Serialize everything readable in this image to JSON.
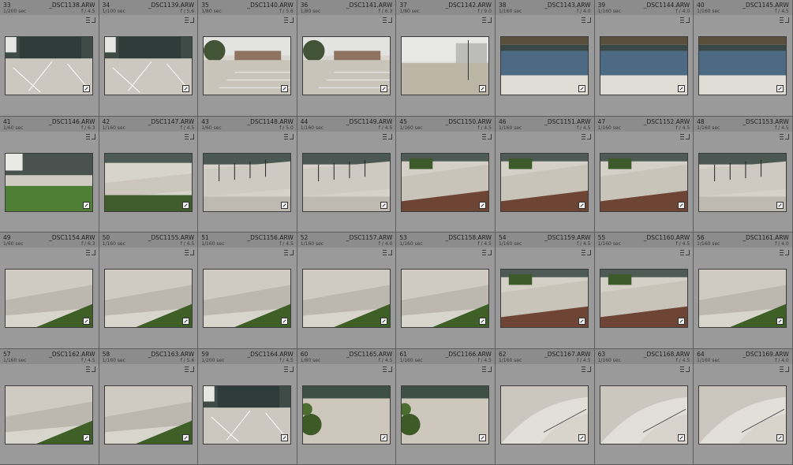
{
  "cells": [
    {
      "index": "33",
      "filename": "_DSC1138.ARW",
      "shutter": "1/200 sec",
      "aperture": "f / 4.5",
      "scene": "plaza-building"
    },
    {
      "index": "34",
      "filename": "_DSC1139.ARW",
      "shutter": "1/100 sec",
      "aperture": "f / 5.6",
      "scene": "plaza-building"
    },
    {
      "index": "35",
      "filename": "_DSC1140.ARW",
      "shutter": "1/80 sec",
      "aperture": "f / 5.6",
      "scene": "steps-tree"
    },
    {
      "index": "36",
      "filename": "_DSC1141.ARW",
      "shutter": "1/80 sec",
      "aperture": "f / 6.3",
      "scene": "steps-tree"
    },
    {
      "index": "37",
      "filename": "_DSC1142.ARW",
      "shutter": "1/80 sec",
      "aperture": "f / 9.0",
      "scene": "plaza-lamp"
    },
    {
      "index": "38",
      "filename": "_DSC1143.ARW",
      "shutter": "1/160 sec",
      "aperture": "f / 4.0",
      "scene": "facade"
    },
    {
      "index": "39",
      "filename": "_DSC1144.ARW",
      "shutter": "1/160 sec",
      "aperture": "f / 4.0",
      "scene": "facade"
    },
    {
      "index": "40",
      "filename": "_DSC1145.ARW",
      "shutter": "1/160 sec",
      "aperture": "f / 4.5",
      "scene": "facade"
    },
    {
      "index": "41",
      "filename": "_DSC1146.ARW",
      "shutter": "1/60 sec",
      "aperture": "f / 6.3",
      "scene": "lawn"
    },
    {
      "index": "42",
      "filename": "_DSC1147.ARW",
      "shutter": "1/160 sec",
      "aperture": "f / 4.5",
      "scene": "ramp-hedge"
    },
    {
      "index": "43",
      "filename": "_DSC1148.ARW",
      "shutter": "1/60 sec",
      "aperture": "f / 5.0",
      "scene": "ramp-rail"
    },
    {
      "index": "44",
      "filename": "_DSC1149.ARW",
      "shutter": "1/160 sec",
      "aperture": "f / 4.5",
      "scene": "ramp-rail"
    },
    {
      "index": "45",
      "filename": "_DSC1150.ARW",
      "shutter": "1/160 sec",
      "aperture": "f / 4.5",
      "scene": "ramp-red"
    },
    {
      "index": "46",
      "filename": "_DSC1151.ARW",
      "shutter": "1/160 sec",
      "aperture": "f / 4.5",
      "scene": "ramp-red"
    },
    {
      "index": "47",
      "filename": "_DSC1152.ARW",
      "shutter": "1/160 sec",
      "aperture": "f / 4.5",
      "scene": "ramp-red"
    },
    {
      "index": "48",
      "filename": "_DSC1153.ARW",
      "shutter": "1/160 sec",
      "aperture": "f / 4.5",
      "scene": "ramp-rail"
    },
    {
      "index": "49",
      "filename": "_DSC1154.ARW",
      "shutter": "1/60 sec",
      "aperture": "f / 6.3",
      "scene": "wall-hedge"
    },
    {
      "index": "50",
      "filename": "_DSC1155.ARW",
      "shutter": "1/160 sec",
      "aperture": "f / 4.5",
      "scene": "wall-hedge"
    },
    {
      "index": "51",
      "filename": "_DSC1156.ARW",
      "shutter": "1/160 sec",
      "aperture": "f / 4.5",
      "scene": "wall-hedge"
    },
    {
      "index": "52",
      "filename": "_DSC1157.ARW",
      "shutter": "1/160 sec",
      "aperture": "f / 4.0",
      "scene": "wall-hedge"
    },
    {
      "index": "53",
      "filename": "_DSC1158.ARW",
      "shutter": "1/160 sec",
      "aperture": "f / 4.5",
      "scene": "wall-hedge"
    },
    {
      "index": "54",
      "filename": "_DSC1159.ARW",
      "shutter": "1/160 sec",
      "aperture": "f / 4.5",
      "scene": "ramp-red"
    },
    {
      "index": "55",
      "filename": "_DSC1160.ARW",
      "shutter": "1/160 sec",
      "aperture": "f / 4.5",
      "scene": "ramp-red"
    },
    {
      "index": "56",
      "filename": "_DSC1161.ARW",
      "shutter": "1/160 sec",
      "aperture": "f / 4.0",
      "scene": "wall-hedge"
    },
    {
      "index": "57",
      "filename": "_DSC1162.ARW",
      "shutter": "1/160 sec",
      "aperture": "f / 4.5",
      "scene": "wall-hedge"
    },
    {
      "index": "58",
      "filename": "_DSC1163.ARW",
      "shutter": "1/160 sec",
      "aperture": "f / 5.6",
      "scene": "wall-hedge"
    },
    {
      "index": "59",
      "filename": "_DSC1164.ARW",
      "shutter": "1/200 sec",
      "aperture": "f / 4.5",
      "scene": "plaza-building"
    },
    {
      "index": "60",
      "filename": "_DSC1165.ARW",
      "shutter": "1/80 sec",
      "aperture": "f / 4.5",
      "scene": "plaza-leaves"
    },
    {
      "index": "61",
      "filename": "_DSC1166.ARW",
      "shutter": "1/160 sec",
      "aperture": "f / 4.5",
      "scene": "plaza-leaves"
    },
    {
      "index": "62",
      "filename": "_DSC1167.ARW",
      "shutter": "1/160 sec",
      "aperture": "f / 4.5",
      "scene": "stairs-curved"
    },
    {
      "index": "63",
      "filename": "_DSC1168.ARW",
      "shutter": "1/160 sec",
      "aperture": "f / 4.5",
      "scene": "stairs-curved"
    },
    {
      "index": "64",
      "filename": "_DSC1169.ARW",
      "shutter": "1/160 sec",
      "aperture": "f / 4.0",
      "scene": "stairs-curved"
    }
  ]
}
